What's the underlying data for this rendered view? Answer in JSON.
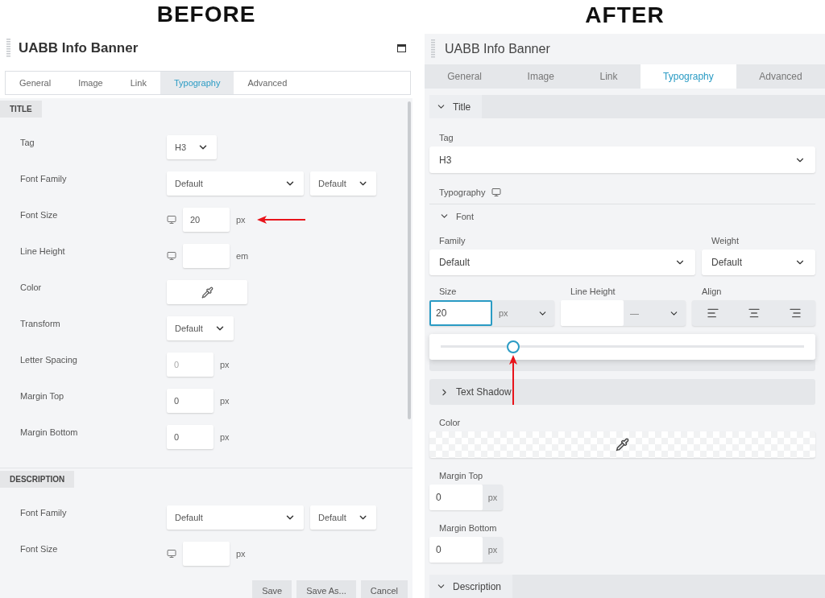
{
  "before": {
    "heading": "BEFORE",
    "title": "UABB Info Banner",
    "tabs": [
      {
        "label": "General",
        "selected": false
      },
      {
        "label": "Image",
        "selected": false
      },
      {
        "label": "Link",
        "selected": false
      },
      {
        "label": "Typography",
        "selected": true
      },
      {
        "label": "Advanced",
        "selected": false
      }
    ],
    "sections": [
      {
        "title": "TITLE",
        "rows": [
          {
            "kind": "select",
            "label": "Tag",
            "value": "H3"
          },
          {
            "kind": "select_pair",
            "label": "Font Family",
            "value": "Default",
            "value2": "Default"
          },
          {
            "kind": "unit_input",
            "label": "Font Size",
            "value": "20",
            "unit": "px",
            "responsive": true,
            "marked": true
          },
          {
            "kind": "unit_input",
            "label": "Line Height",
            "unit": "em",
            "responsive": true
          },
          {
            "kind": "color",
            "label": "Color"
          },
          {
            "kind": "select",
            "label": "Transform",
            "value": "Default"
          },
          {
            "kind": "unit_input",
            "label": "Letter Spacing",
            "placeholder": "0",
            "unit": "px"
          },
          {
            "kind": "unit_input",
            "label": "Margin Top",
            "value": "0",
            "unit": "px"
          },
          {
            "kind": "unit_input",
            "label": "Margin Bottom",
            "value": "0",
            "unit": "px"
          }
        ]
      },
      {
        "title": "DESCRIPTION",
        "rows": [
          {
            "kind": "select_pair",
            "label": "Font Family",
            "value": "Default",
            "value2": "Default"
          },
          {
            "kind": "unit_input",
            "label": "Font Size",
            "unit": "px",
            "responsive": true
          }
        ]
      }
    ],
    "buttons": [
      "Save",
      "Save As...",
      "Cancel"
    ]
  },
  "after": {
    "heading": "AFTER",
    "title": "UABB Info Banner",
    "tabs": [
      {
        "label": "General",
        "selected": false
      },
      {
        "label": "Image",
        "selected": false
      },
      {
        "label": "Link",
        "selected": false
      },
      {
        "label": "Typography",
        "selected": true
      },
      {
        "label": "Advanced",
        "selected": false
      }
    ],
    "sections": [
      {
        "title": "Title",
        "expanded": true,
        "tag": {
          "label": "Tag",
          "value": "H3"
        },
        "typography": {
          "label": "Typography",
          "responsive": true,
          "font": {
            "title": "Font",
            "expanded": true,
            "family": {
              "label": "Family",
              "value": "Default"
            },
            "weight": {
              "label": "Weight",
              "value": "Default"
            },
            "size": {
              "label": "Size",
              "value": "20",
              "unit": "px",
              "focused": true
            },
            "line_height": {
              "label": "Line Height",
              "unit": "—"
            },
            "align": {
              "label": "Align",
              "options": [
                {
                  "kind": "left"
                },
                {
                  "kind": "center"
                },
                {
                  "kind": "right"
                }
              ]
            },
            "slider": {
              "level": 0.2,
              "marked": true
            }
          },
          "groups": [
            {
              "title": "Text Shadow",
              "expanded": false
            }
          ]
        },
        "color": {
          "label": "Color"
        },
        "margins": [
          {
            "label": "Margin Top",
            "value": "0",
            "unit": "px"
          },
          {
            "label": "Margin Bottom",
            "value": "0",
            "unit": "px"
          }
        ]
      },
      {
        "title": "Description",
        "expanded": true
      }
    ]
  }
}
